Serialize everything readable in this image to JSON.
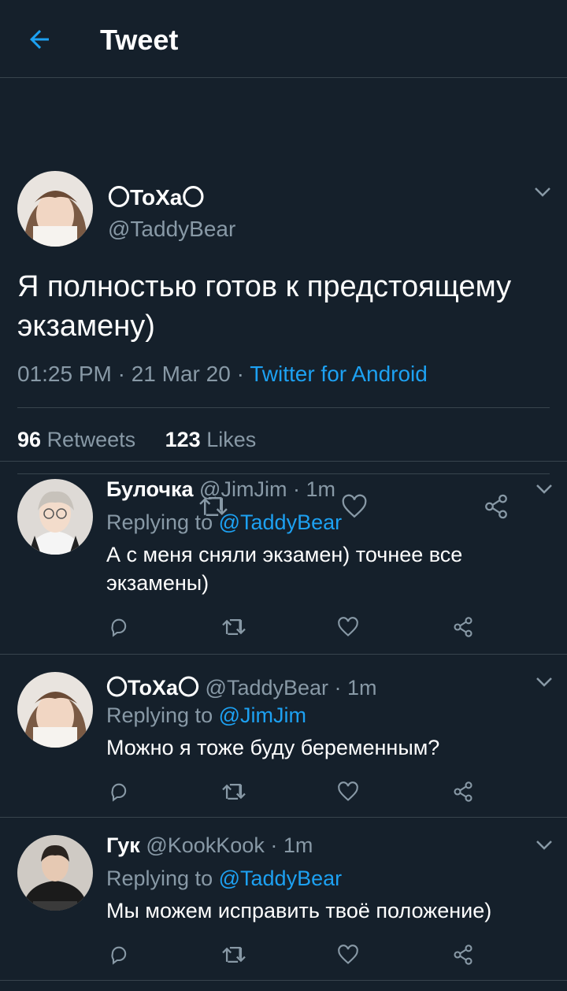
{
  "header": {
    "title": "Tweet"
  },
  "tweet": {
    "name": "〇ToXa〇",
    "handle": "@TaddyBear",
    "text": "Я полностью готов к предстоящему экзамену)",
    "time": "01:25 PM · 21 Mar 20 · ",
    "source": "Twitter for Android",
    "retweets": "96",
    "retweets_label": "Retweets",
    "likes": "123",
    "likes_label": "Likes"
  },
  "replies": [
    {
      "name": "Булочка",
      "handle": "@JimJim",
      "time": "· 1m",
      "replying_label": "Replying to",
      "replying_to": "@TaddyBear",
      "text": "А с меня сняли экзамен) точнее все экзамены)"
    },
    {
      "name": "〇ToXa〇",
      "handle": "@TaddyBear",
      "time": "· 1m",
      "replying_label": "Replying to",
      "replying_to": "@JimJim",
      "text": "Можно я тоже буду беременным?"
    },
    {
      "name": "Гук",
      "handle": "@KookKook",
      "time": "· 1m",
      "replying_label": "Replying to",
      "replying_to": "@TaddyBear",
      "text": "Мы можем исправить твоё положение)"
    }
  ],
  "icons": [
    "back-arrow-icon",
    "chevron-down-icon",
    "reply-icon",
    "retweet-icon",
    "like-icon",
    "share-icon"
  ],
  "colors": {
    "background": "#15202b",
    "accent": "#1da1f2",
    "secondary_text": "#8899a6",
    "divider": "#38444d"
  }
}
